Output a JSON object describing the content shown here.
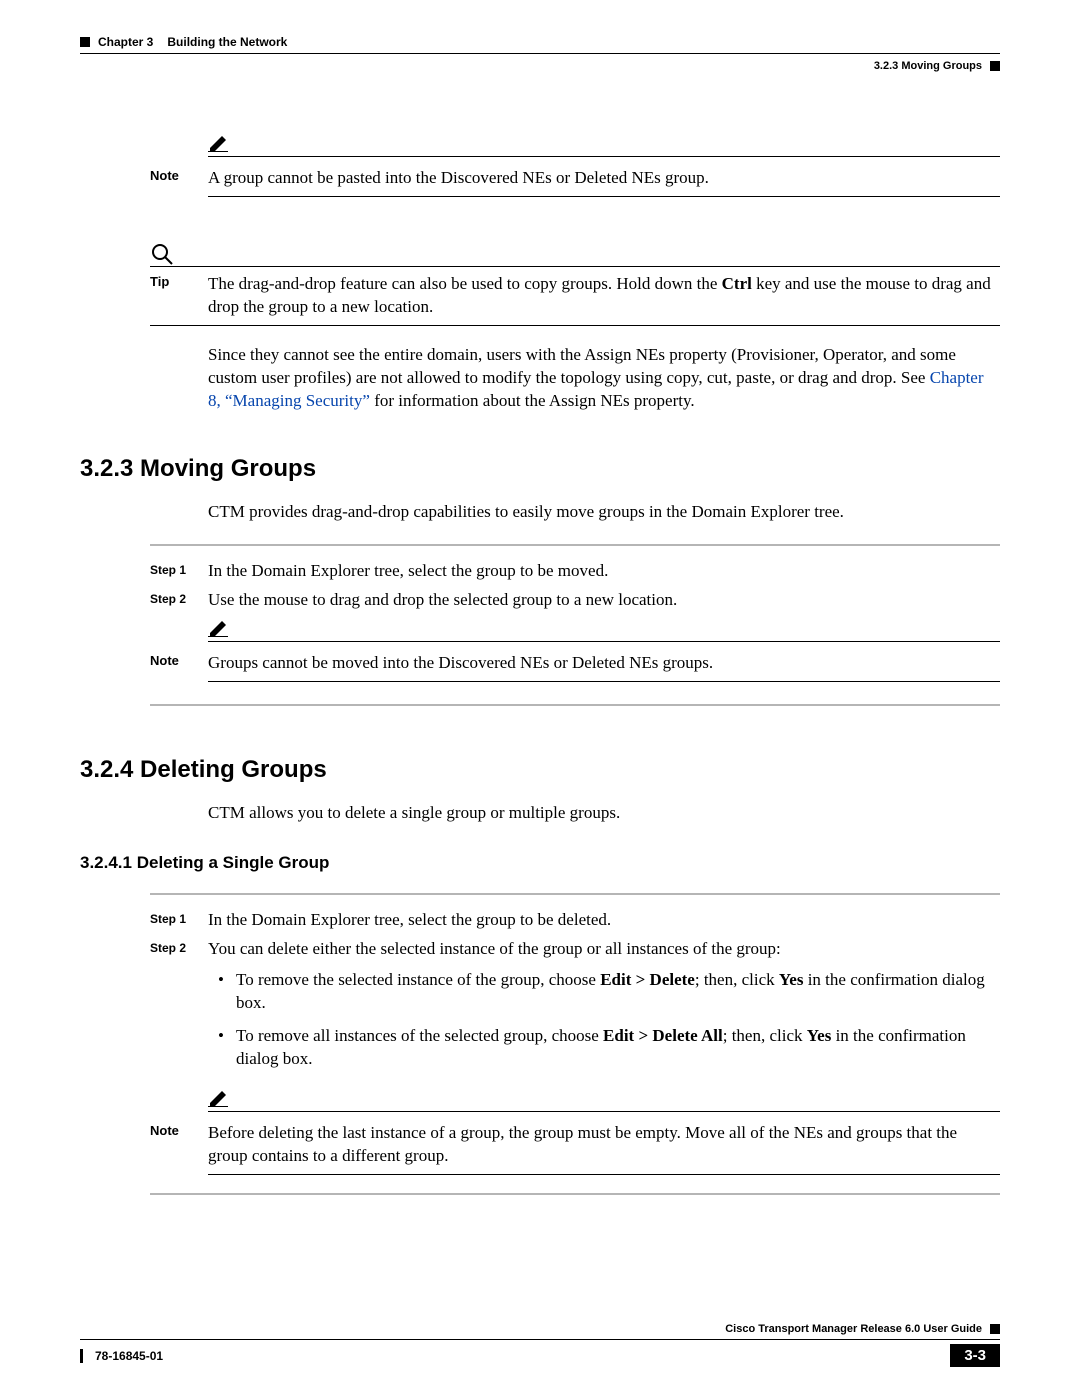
{
  "header": {
    "chapter_label": "Chapter 3",
    "chapter_title": "Building the Network",
    "section_ref": "3.2.3  Moving Groups"
  },
  "note1": {
    "label": "Note",
    "text": "A group cannot be pasted into the Discovered NEs or Deleted NEs group."
  },
  "tip": {
    "label": "Tip",
    "text_a": "The drag-and-drop feature can also be used to copy groups. Hold down the ",
    "text_bold1": "Ctrl",
    "text_b": " key and use the mouse to drag and drop the group to a new location."
  },
  "para1_a": "Since they cannot see the entire domain, users with the Assign NEs property (Provisioner, Operator, and some custom user profiles) are not allowed to modify the topology using copy, cut, paste, or drag and drop. See ",
  "para1_link": "Chapter 8, “Managing Security”",
  "para1_b": " for information about the Assign NEs property.",
  "sec323": {
    "title": "3.2.3  Moving Groups",
    "intro": "CTM provides drag-and-drop capabilities to easily move groups in the Domain Explorer tree.",
    "step1_label": "Step 1",
    "step1": "In the Domain Explorer tree, select the group to be moved.",
    "step2_label": "Step 2",
    "step2": "Use the mouse to drag and drop the selected group to a new location.",
    "note_label": "Note",
    "note": "Groups cannot be moved into the Discovered NEs or Deleted NEs groups."
  },
  "sec324": {
    "title": "3.2.4  Deleting Groups",
    "intro": "CTM allows you to delete a single group or multiple groups."
  },
  "sec3241": {
    "title": "3.2.4.1  Deleting a Single Group",
    "step1_label": "Step 1",
    "step1": "In the Domain Explorer tree, select the group to be deleted.",
    "step2_label": "Step 2",
    "step2": "You can delete either the selected instance of the group or all instances of the group:",
    "b1_a": "To remove the selected instance of the group, choose ",
    "b1_bold1": "Edit > Delete",
    "b1_b": "; then, click ",
    "b1_bold2": "Yes",
    "b1_c": " in the confirmation dialog box.",
    "b2_a": "To remove all instances of the selected group, choose ",
    "b2_bold1": "Edit > Delete All",
    "b2_b": "; then, click ",
    "b2_bold2": "Yes",
    "b2_c": " in the confirmation dialog box.",
    "note_label": "Note",
    "note": "Before deleting the last instance of a group, the group must be empty. Move all of the NEs and groups that the group contains to a different group."
  },
  "footer": {
    "guide": "Cisco Transport Manager Release 6.0 User Guide",
    "docnum": "78-16845-01",
    "page": "3-3"
  }
}
